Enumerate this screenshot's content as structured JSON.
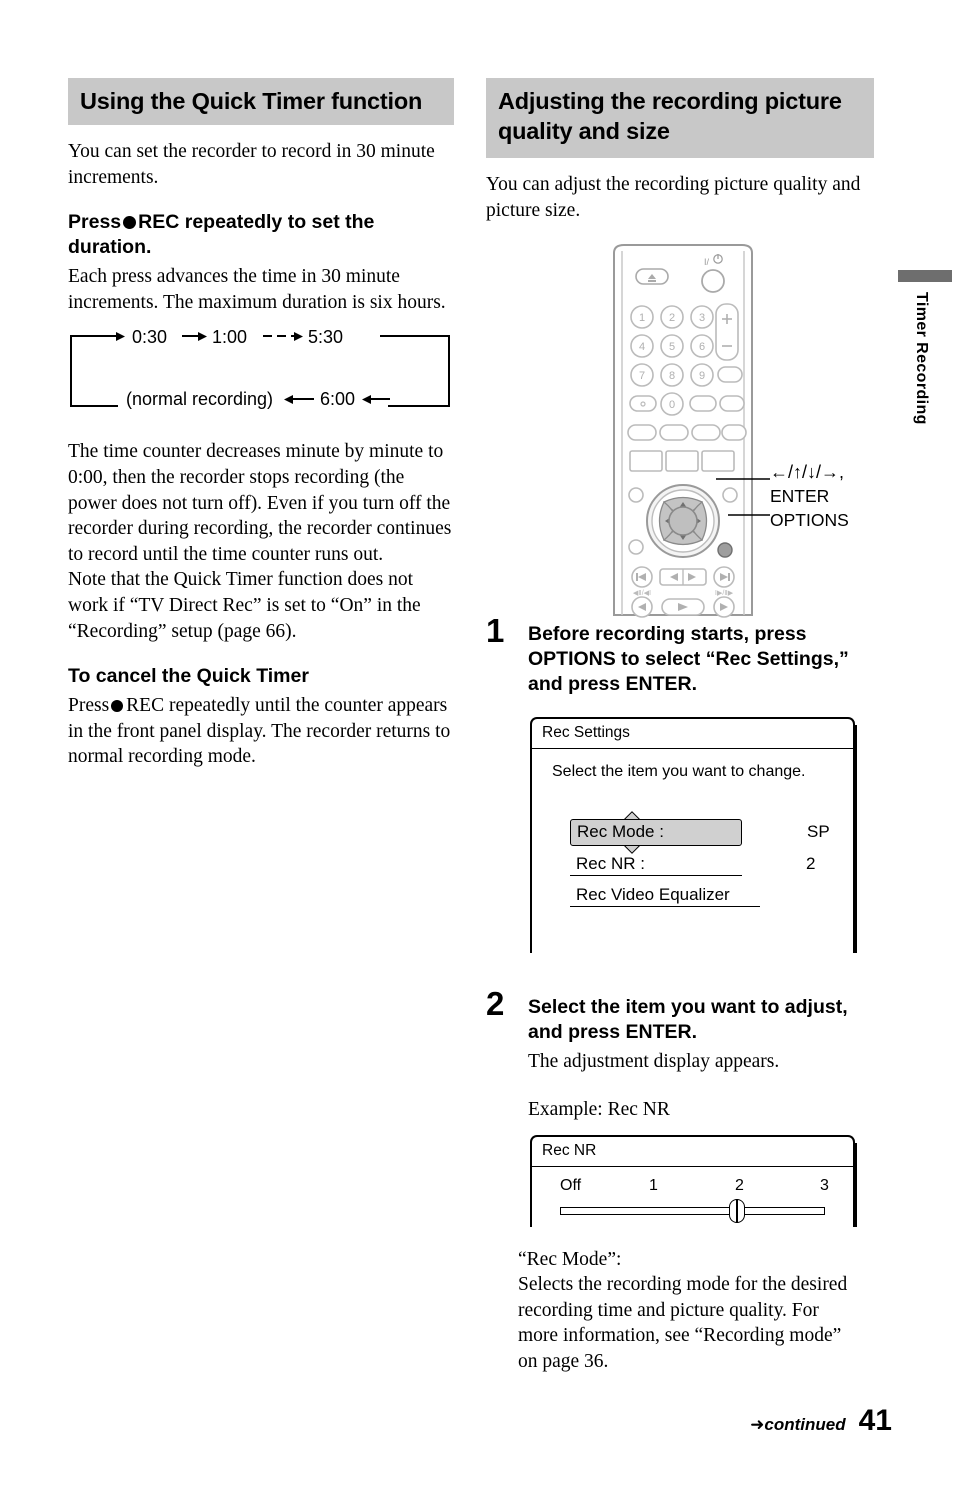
{
  "left_column": {
    "section_title": "Using the Quick Timer function",
    "intro": "You can set the recorder to record in 30 minute increments.",
    "press_heading_before": "Press",
    "press_heading_after": "REC repeatedly to set the duration.",
    "press_body": "Each press advances the time in 30 minute increments. The maximum duration is six hours.",
    "flow": {
      "items": [
        "0:30",
        "1:00",
        "5:30",
        "6:00"
      ],
      "normal_label": "(normal recording)"
    },
    "counter_body": "The time counter decreases minute by minute to 0:00, then the recorder stops recording (the power does not turn off). Even if you turn off the recorder during recording, the recorder continues to record until the time counter runs out.",
    "note_body": "Note that the Quick Timer function does not work if “TV Direct Rec” is set to “On” in the “Recording” setup (page 66).",
    "cancel_heading": "To cancel the Quick Timer",
    "cancel_before": "Press",
    "cancel_after": "REC repeatedly until the counter appears in the front panel display. The recorder returns to normal recording mode."
  },
  "right_column": {
    "section_title": "Adjusting the recording picture quality and size",
    "intro": "You can adjust the recording picture quality and picture size.",
    "callouts": {
      "directions": "←/↑/↓/→,",
      "enter": "ENTER",
      "options": "OPTIONS"
    },
    "step1": {
      "number": "1",
      "title": "Before recording starts, press OPTIONS to select “Rec Settings,” and press ENTER."
    },
    "rec_settings_dialog": {
      "title": "Rec Settings",
      "instruction": "Select the item you want to change.",
      "rows": [
        {
          "label": "Rec Mode :",
          "value": "SP",
          "selected": true
        },
        {
          "label": "Rec NR :",
          "value": "2",
          "selected": false
        },
        {
          "label": "Rec Video Equalizer",
          "value": "",
          "selected": false
        }
      ]
    },
    "step2": {
      "number": "2",
      "title": "Select the item you want to adjust, and press ENTER.",
      "body": "The adjustment display appears.",
      "example": "Example: Rec NR"
    },
    "rec_nr_dialog": {
      "title": "Rec NR",
      "scale": [
        "Off",
        "1",
        "2",
        "3"
      ],
      "selected_index": 2
    },
    "rec_mode_label": "“Rec Mode”:",
    "rec_mode_body": "Selects the recording mode for the desired recording time and picture quality. For more information, see “Recording mode” on page 36."
  },
  "side_tab": {
    "label": "Timer Recording"
  },
  "footer": {
    "continued": "continued",
    "page_number": "41"
  }
}
